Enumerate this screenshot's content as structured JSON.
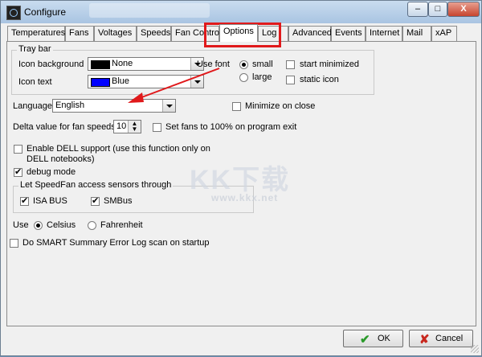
{
  "window": {
    "title": "Configure",
    "controls": {
      "minimize": "–",
      "maximize": "□",
      "close": "X"
    }
  },
  "tabs": [
    "Temperatures",
    "Fans",
    "Voltages",
    "Speeds",
    "Fan Control",
    "Options",
    "Log",
    "Advanced",
    "Events",
    "Internet",
    "Mail",
    "xAP"
  ],
  "active_tab": "Options",
  "tray": {
    "group_label": "Tray bar",
    "icon_background_label": "Icon background",
    "icon_background_value": "None",
    "icon_background_color": "#000000",
    "icon_text_label": "Icon text",
    "icon_text_value": "Blue",
    "icon_text_color": "#0000ff",
    "use_font_label": "Use font",
    "font_small": "small",
    "font_large": "large",
    "start_minimized": "start minimized",
    "static_icon": "static icon"
  },
  "language": {
    "label": "Language",
    "value": "English"
  },
  "minimize_on_close": "Minimize on close",
  "delta": {
    "label": "Delta value for fan speeds",
    "value": "10"
  },
  "set_fans_100": "Set fans to 100% on program exit",
  "dell": {
    "line1": "Enable DELL support (use this function only on",
    "line2": "DELL notebooks)"
  },
  "debug_mode": "debug mode",
  "sensors": {
    "group_label": "Let SpeedFan access sensors through",
    "isa_bus": "ISA BUS",
    "smbus": "SMBus"
  },
  "units": {
    "label": "Use",
    "celsius": "Celsius",
    "fahrenheit": "Fahrenheit"
  },
  "smart_scan": "Do SMART Summary Error Log scan on startup",
  "buttons": {
    "ok": "OK",
    "cancel": "Cancel"
  },
  "watermark": {
    "main": "KK下载",
    "sub": "www.kkx.net"
  },
  "annotation_color": "#e0191b"
}
